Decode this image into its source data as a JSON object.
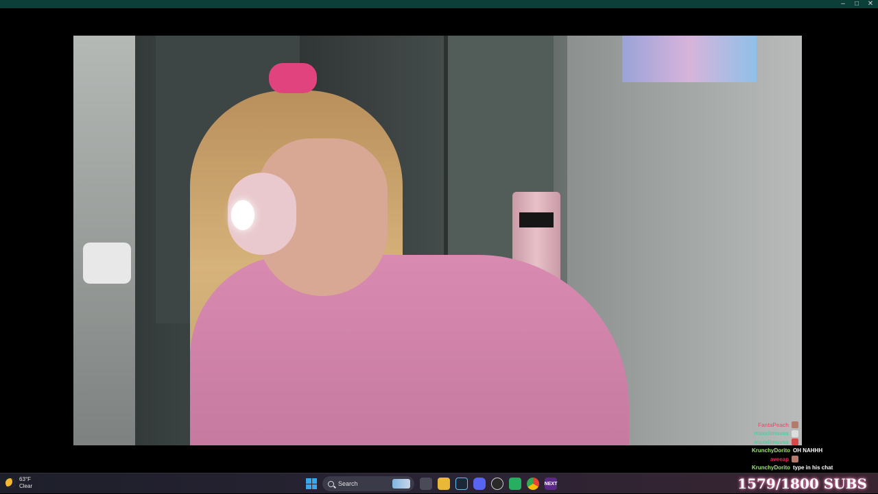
{
  "window": {
    "controls": [
      "–",
      "□",
      "✕"
    ]
  },
  "chat": [
    {
      "user": "FantaPeach",
      "message": "",
      "user_color": "#e0607a",
      "side": "left"
    },
    {
      "user": "maxxiimuuss",
      "message": "",
      "user_color": "#57c9a0",
      "side": "left"
    },
    {
      "user": "maxxiimuuss",
      "message": "",
      "user_color": "#57c9a0",
      "side": "left"
    },
    {
      "user": "KrunchyDorito",
      "message": "OH NAHHH",
      "user_color": "#9fe870",
      "side": "right"
    },
    {
      "user": "aveeap",
      "message": "",
      "user_color": "#e02f5a",
      "side": "left"
    },
    {
      "user": "KrunchyDorito",
      "message": "type in his chat",
      "user_color": "#9fe870",
      "side": "right"
    }
  ],
  "taskbar": {
    "weather_temp": "63°F",
    "weather_cond": "Clear",
    "search_label": "Search",
    "next_label": "NEXT",
    "sub_goal": "1579/1800 SUBS"
  },
  "colors": {
    "titlebar": "#0c3f38",
    "accent_pink": "#e57fb1"
  }
}
